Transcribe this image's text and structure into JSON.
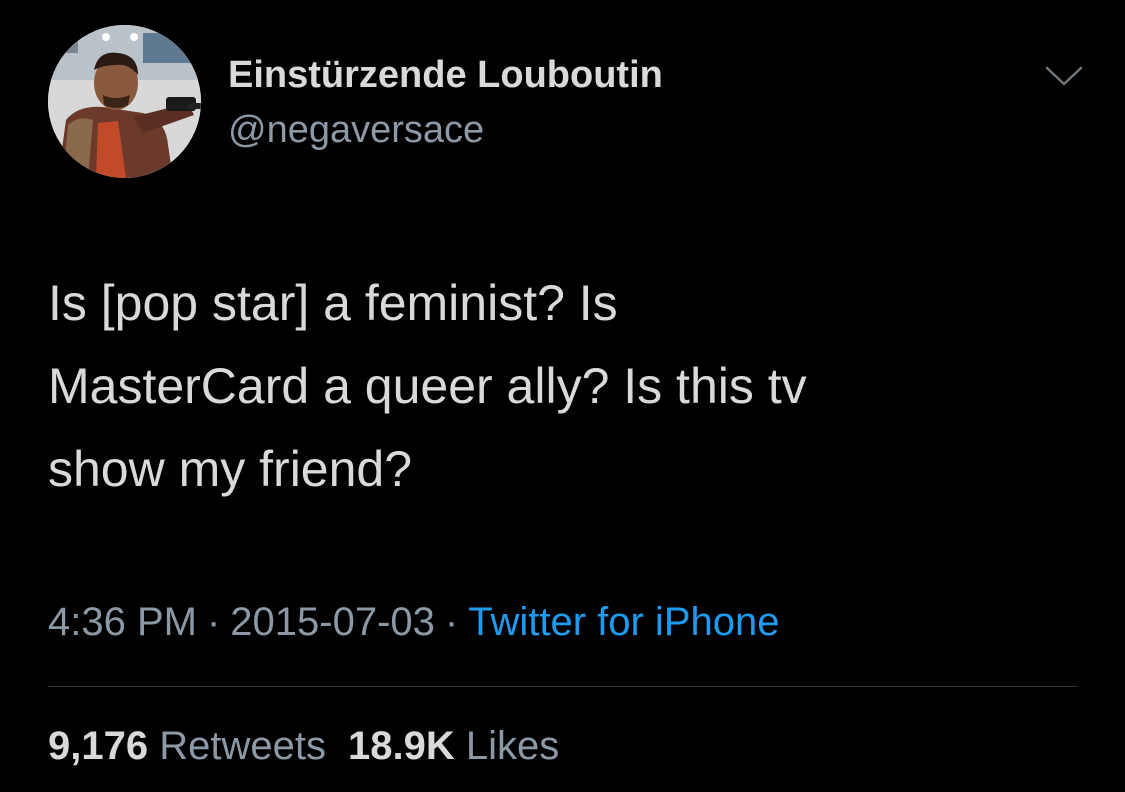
{
  "user": {
    "display_name": "Einstürzende Louboutin",
    "handle": "@negaversace",
    "avatar_icon": "profile-photo"
  },
  "tweet": {
    "lines": [
      "Is [pop star] a feminist? Is",
      "MasterCard a queer ally? Is this tv",
      "show my friend?"
    ]
  },
  "meta": {
    "time": "4:36 PM",
    "separator": "·",
    "date": "2015-07-03",
    "source": "Twitter for iPhone"
  },
  "stats": {
    "retweets_count": "9,176",
    "retweets_label": "Retweets",
    "likes_count": "18.9K",
    "likes_label": "Likes"
  },
  "colors": {
    "background": "#000000",
    "text": "#d9d9d9",
    "secondary": "#8b98a5",
    "link": "#1d9bf0",
    "divider": "#2f3336"
  }
}
